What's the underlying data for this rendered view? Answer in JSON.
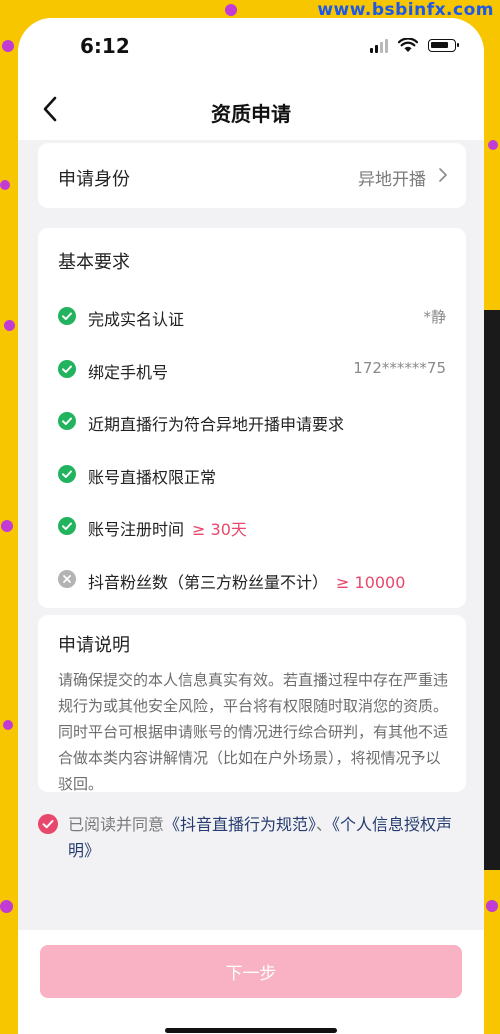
{
  "watermark": "www.bsbinfx.com",
  "status_bar": {
    "time": "6:12"
  },
  "nav": {
    "title": "资质申请"
  },
  "identity": {
    "label": "申请身份",
    "value": "异地开播"
  },
  "requirements": {
    "title": "基本要求",
    "items": [
      {
        "label": "完成实名认证",
        "value": "*静",
        "target": "",
        "status": "done"
      },
      {
        "label": "绑定手机号",
        "value": "172******75",
        "target": "",
        "status": "done"
      },
      {
        "label": "近期直播行为符合异地开播申请要求",
        "value": "",
        "target": "",
        "status": "done"
      },
      {
        "label": "账号直播权限正常",
        "value": "",
        "target": "",
        "status": "done"
      },
      {
        "label": "账号注册时间",
        "value": "",
        "target": "≥ 30天",
        "status": "done"
      },
      {
        "label": "抖音粉丝数（第三方粉丝量不计）",
        "value": "",
        "target": "≥ 10000",
        "status": "failed"
      }
    ]
  },
  "description": {
    "title": "申请说明",
    "text": "请确保提交的本人信息真实有效。若直播过程中存在严重违规行为或其他安全风险，平台将有权限随时取消您的资质。同时平台可根据申请账号的情况进行综合研判，有其他不适合做本类内容讲解情况（比如在户外场景），将视情况予以驳回。"
  },
  "agreement": {
    "prefix": "已阅读并同意",
    "link1": "《抖音直播行为规范》",
    "separator": "、",
    "link2": "《个人信息授权声明》",
    "checked": true
  },
  "footer": {
    "next_label": "下一步"
  },
  "colors": {
    "accent": "#e8486c",
    "check_green": "#22b35e",
    "fail_gray": "#b3b3b3",
    "button_disabled": "#f8b2c4",
    "link": "#253c70"
  }
}
